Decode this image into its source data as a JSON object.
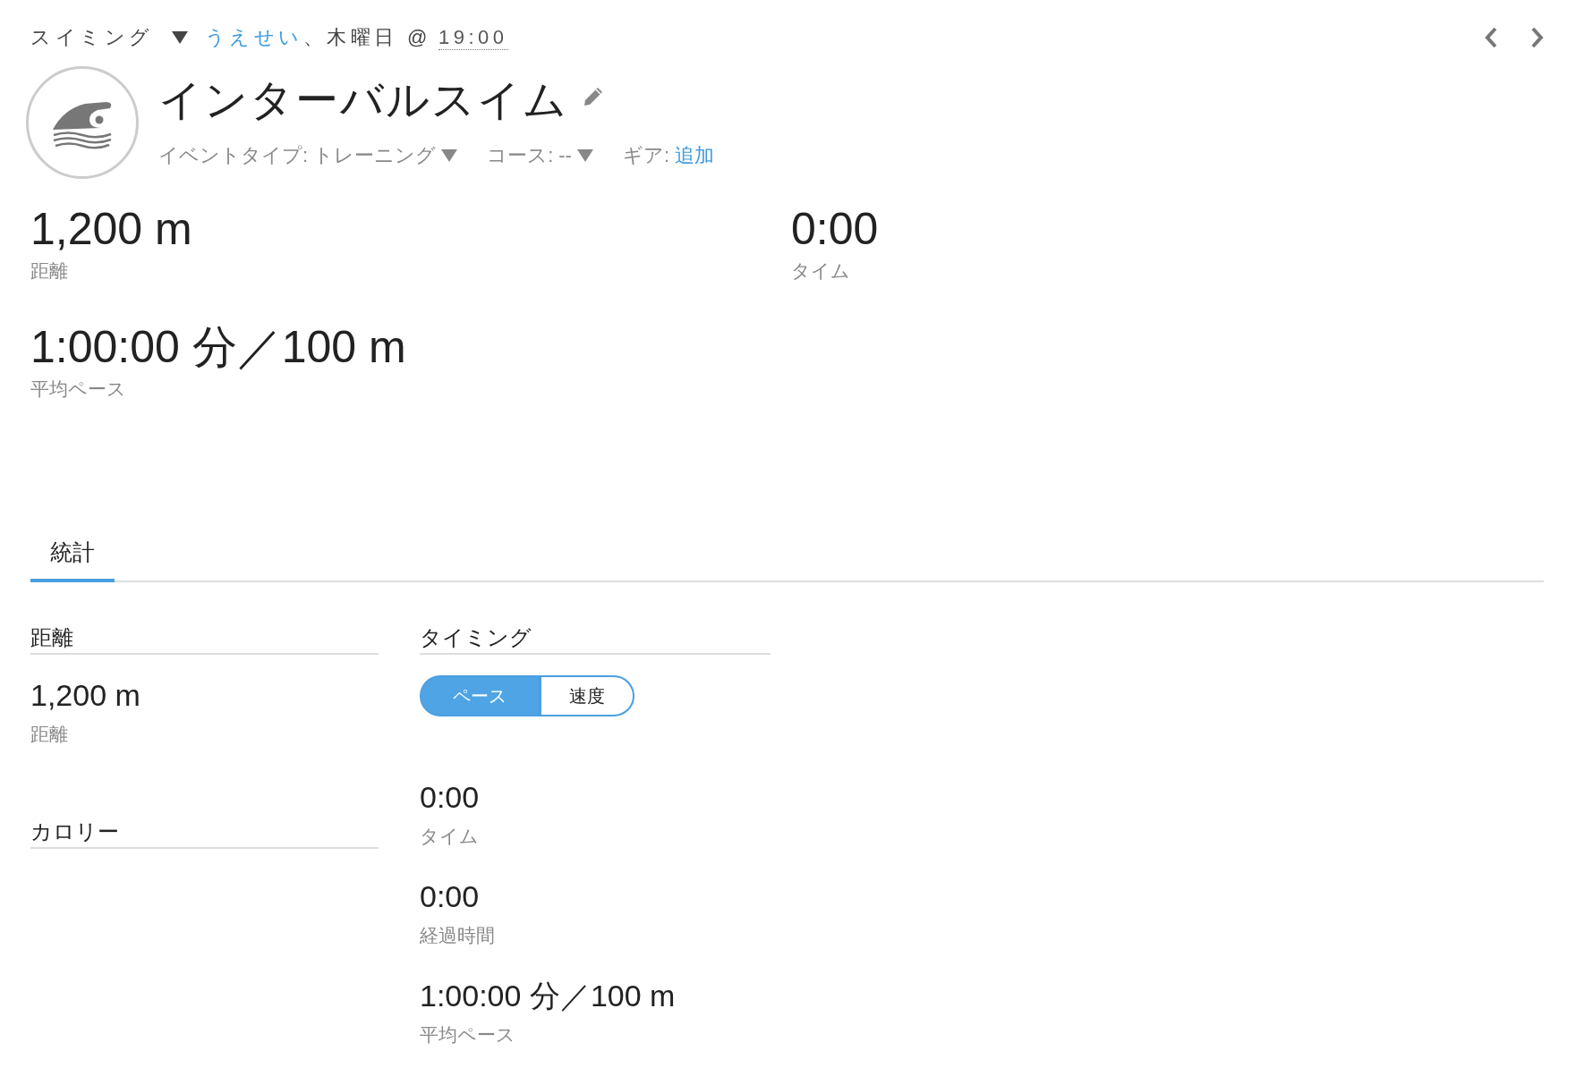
{
  "header": {
    "sport": "スイミング",
    "user": "うえせい",
    "date": "、木曜日 @",
    "time": "19:00"
  },
  "title": "インターバルスイム",
  "meta": [
    {
      "kind": "dropdown",
      "label": "イベントタイプ:",
      "value": "トレーニング"
    },
    {
      "kind": "dropdown",
      "label": "コース:",
      "value": "--"
    },
    {
      "kind": "link",
      "label": "ギア:",
      "value": "追加"
    }
  ],
  "summary": [
    {
      "value": "1,200 m",
      "label": "距離"
    },
    {
      "value": "0:00",
      "label": "タイム"
    },
    {
      "value": "1:00:00 分／100 m",
      "label": "平均ペース"
    }
  ],
  "tabs": [
    {
      "label": "統計",
      "selected": true
    }
  ],
  "distance": {
    "title": "距離",
    "stats": [
      {
        "value": "1,200 m",
        "label": "距離"
      }
    ]
  },
  "calories": {
    "title": "カロリー"
  },
  "timing": {
    "title": "タイミング",
    "modes": [
      {
        "label": "ペース",
        "selected": true
      },
      {
        "label": "速度",
        "selected": false
      }
    ],
    "stats": [
      {
        "value": "0:00",
        "label": "タイム"
      },
      {
        "value": "0:00",
        "label": "経過時間"
      },
      {
        "value": "1:00:00 分／100 m",
        "label": "平均ペース"
      }
    ]
  }
}
